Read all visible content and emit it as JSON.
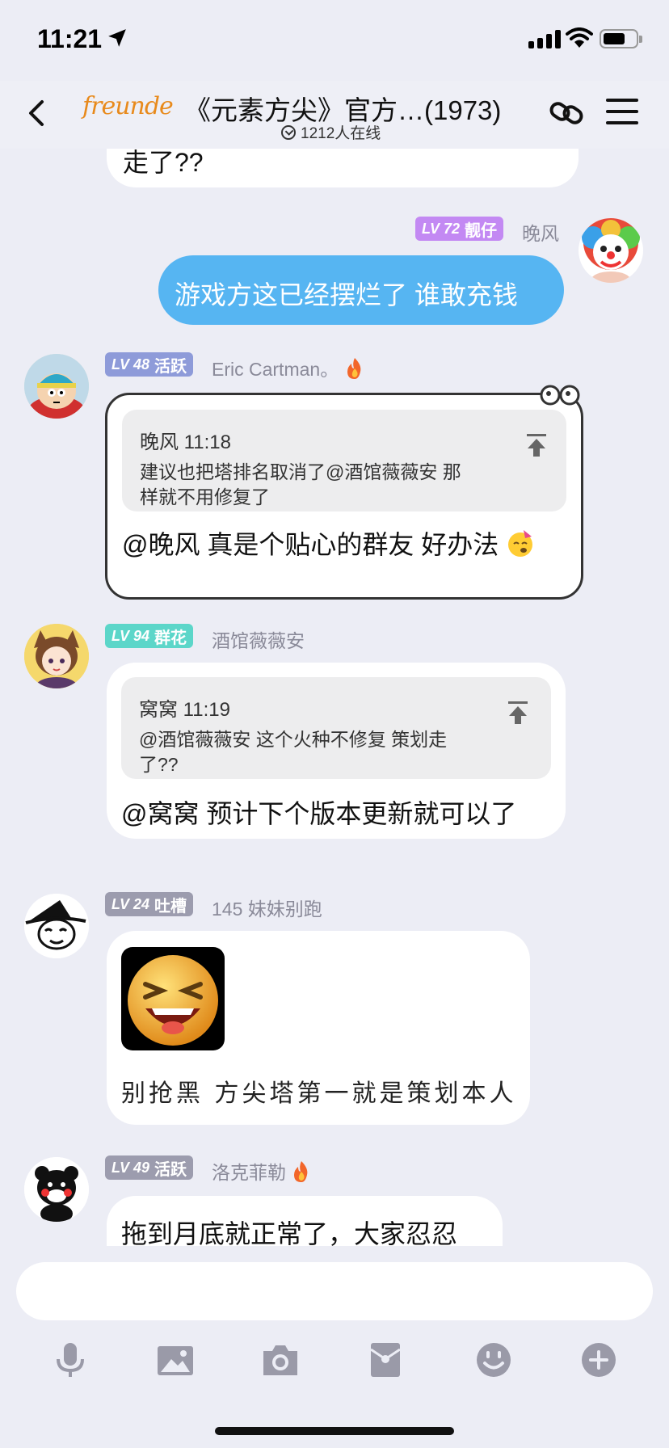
{
  "status": {
    "time": "11:21"
  },
  "header": {
    "logo_text": "freunde",
    "title": "《元素方尖》官方…(1973)",
    "online": "1212人在线"
  },
  "colors": {
    "accent_blue": "#56B5F2",
    "lv72": "#C389F3",
    "lv48": "#8E9BD9",
    "lv94": "#5CD6C9",
    "lv24": "#9C9CAE"
  },
  "messages": [
    {
      "partial_text": "走了??"
    },
    {
      "badge_lv": "LV 72",
      "badge_title": "靓仔",
      "nick": "晚风",
      "text": "游戏方这已经摆烂了 谁敢充钱",
      "avatar_icon": "clown-avatar"
    },
    {
      "badge_lv": "LV 48",
      "badge_title": "活跃",
      "nick": "Eric Cartman。",
      "quote_head": "晚风 11:18",
      "quote_line1": "建议也把塔排名取消了@酒馆薇薇安 那",
      "quote_line2": "样就不用修复了",
      "text": "@晚风 真是个贴心的群友 好办法",
      "avatar_icon": "cartman-avatar"
    },
    {
      "badge_lv": "LV 94",
      "badge_title": "群花",
      "nick": "酒馆薇薇安",
      "quote_head": "窝窝 11:19",
      "quote_line1": "@酒馆薇薇安 这个火种不修复  策划走",
      "quote_line2": "了??",
      "text": "@窝窝 预计下个版本更新就可以了",
      "avatar_icon": "catgirl-avatar"
    },
    {
      "badge_lv": "LV 24",
      "badge_title": "吐槽",
      "nick": "145 妹妹别跑",
      "text": "别抢黑 方尖塔第一就是策划本人",
      "avatar_icon": "witch-avatar"
    },
    {
      "badge_lv": "LV 49",
      "badge_title": "活跃",
      "nick": "洛克菲勒",
      "text": "拖到月底就正常了，大家忍忍",
      "avatar_icon": "kumamon-avatar"
    }
  ],
  "toolbar": [
    "microphone-icon",
    "image-icon",
    "camera-icon",
    "red-packet-icon",
    "emoji-icon",
    "plus-icon"
  ]
}
